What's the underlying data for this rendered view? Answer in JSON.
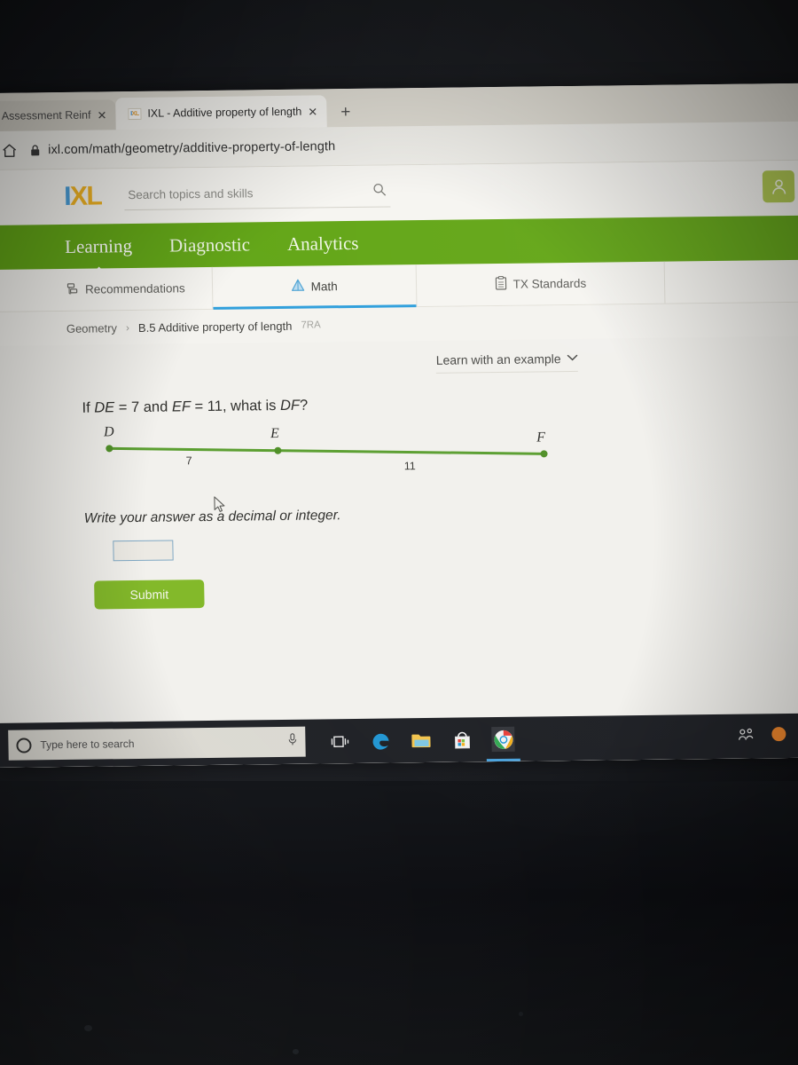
{
  "browser": {
    "tabs": [
      {
        "title": "ks Assessment Reinf",
        "favicon": "",
        "close_label": "✕",
        "active": false
      },
      {
        "title": "IXL - Additive property of length",
        "favicon": "IXL",
        "close_label": "✕",
        "active": true
      }
    ],
    "new_tab_label": "+",
    "address": "ixl.com/math/geometry/additive-property-of-length",
    "home_icon": "home-icon",
    "lock_icon": "lock-icon"
  },
  "ixl": {
    "logo": {
      "part1": "I",
      "part2": "XL"
    },
    "search": {
      "placeholder": "Search topics and skills",
      "icon": "search-icon"
    },
    "avatar": {
      "icon": "user-avatar-icon",
      "color": "#b0c94f"
    },
    "primary_nav": [
      {
        "label": "Learning",
        "active": true
      },
      {
        "label": "Diagnostic",
        "active": false
      },
      {
        "label": "Analytics",
        "active": false
      }
    ],
    "sub_nav": [
      {
        "label": "Recommendations",
        "icon": "recommendations-icon",
        "selected": false
      },
      {
        "label": "Math",
        "icon": "math-pyramid-icon",
        "selected": true
      },
      {
        "label": "TX Standards",
        "icon": "clipboard-icon",
        "selected": false
      }
    ],
    "breadcrumb": {
      "subject": "Geometry",
      "separator": "›",
      "skill": "B.5 Additive property of length",
      "code": "7RA"
    },
    "learn_with_example": {
      "label": "Learn with an example",
      "chevron": "⌄"
    },
    "question": {
      "prefix": "If ",
      "var1": "DE",
      "mid1": " = 7 and ",
      "var2": "EF",
      "mid2": " = 11, what is ",
      "var3": "DF",
      "suffix": "?"
    },
    "instruction": "Write your answer as a decimal or integer.",
    "answer_field": {
      "value": "",
      "placeholder": ""
    },
    "submit_label": "Submit",
    "accent_green": "#82b828",
    "nav_green": "#63a617"
  },
  "chart_data": {
    "type": "diagram",
    "title": "Collinear points D, E, F on a segment",
    "points": [
      {
        "label": "D",
        "x": 0
      },
      {
        "label": "E",
        "x": 7
      },
      {
        "label": "F",
        "x": 18
      }
    ],
    "segment_labels": [
      {
        "label": "7",
        "between": [
          "D",
          "E"
        ]
      },
      {
        "label": "11",
        "between": [
          "E",
          "F"
        ]
      }
    ],
    "line_color": "#5a9e2f",
    "point_color": "#4f8f26"
  },
  "taskbar": {
    "search_placeholder": "Type here to search",
    "cortana_icon": "cortana-circle-icon",
    "mic_icon": "microphone-icon",
    "icons": [
      {
        "name": "task-view-icon",
        "active": false
      },
      {
        "name": "edge-browser-icon",
        "active": false
      },
      {
        "name": "file-explorer-icon",
        "active": false
      },
      {
        "name": "microsoft-store-icon",
        "active": false
      },
      {
        "name": "chrome-browser-icon",
        "active": true
      }
    ],
    "tray": [
      {
        "name": "people-icon"
      },
      {
        "name": "orange-status-icon"
      },
      {
        "name": "blue-tray-icon"
      }
    ]
  }
}
